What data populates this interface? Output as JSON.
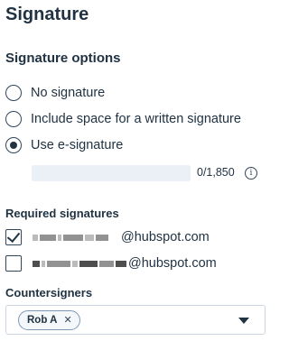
{
  "page": {
    "title": "Signature"
  },
  "signature_options": {
    "heading": "Signature options",
    "options": [
      {
        "label": "No signature",
        "selected": false
      },
      {
        "label": "Include space for a written signature",
        "selected": false
      },
      {
        "label": "Use e-signature",
        "selected": true
      }
    ],
    "char_count": "0/1,850",
    "info_icon": "info-icon"
  },
  "required_signatures": {
    "heading": "Required signatures",
    "signers": [
      {
        "email_domain": "@hubspot.com",
        "checked": true
      },
      {
        "email_domain": "@hubspot.com",
        "checked": false
      }
    ]
  },
  "countersigners": {
    "heading": "Countersigners",
    "selected_tags": [
      {
        "label": "Rob A",
        "remove_icon": "close-icon"
      }
    ],
    "dropdown_icon": "caret-down-icon"
  }
}
